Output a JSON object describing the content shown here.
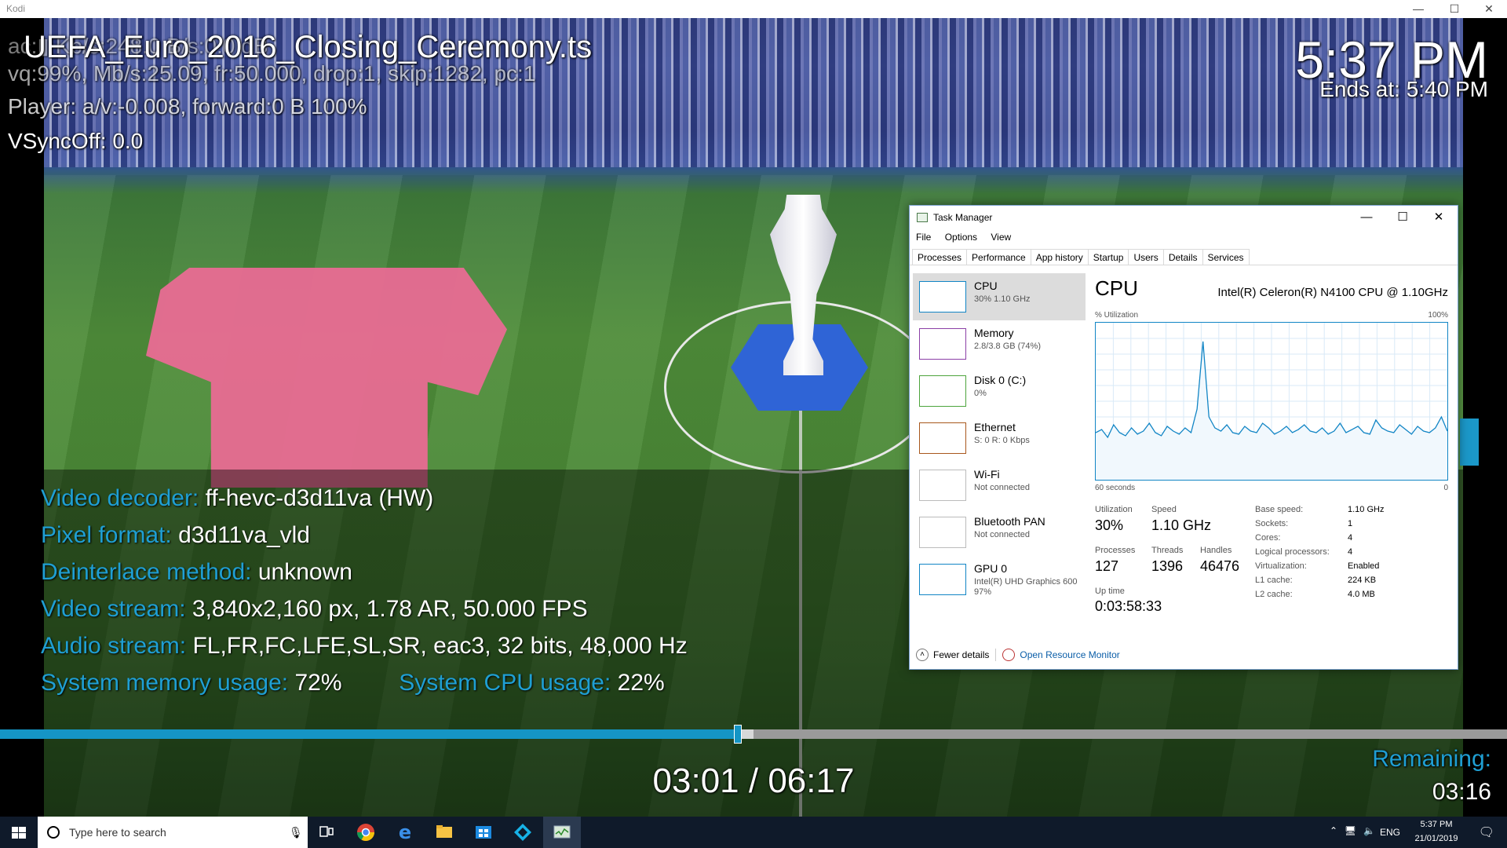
{
  "window": {
    "title": "Kodi"
  },
  "osd": {
    "debug_line1": "ac:▮ Kb/s:248.0 B/s:0.0 dB",
    "debug_line2": "vq:99%, Mb/s:25.09, fr:50.000, drop:1, skip:1282, pc:1",
    "debug_line3": "Player: a/v:-0.008, forward:0 B 100%",
    "debug_line4": "VSyncOff: 0.0",
    "file_title": "UEFA_Euro_2016_Closing_Ceremony.ts",
    "clock": "5:37 PM",
    "ends_at": "Ends at: 5:40 PM"
  },
  "info": {
    "video_decoder_label": "Video decoder:",
    "video_decoder_value": "ff-hevc-d3d11va (HW)",
    "pixel_format_label": "Pixel format:",
    "pixel_format_value": "d3d11va_vld",
    "deinterlace_label": "Deinterlace method:",
    "deinterlace_value": "unknown",
    "video_stream_label": "Video stream:",
    "video_stream_value": "3,840x2,160 px, 1.78 AR, 50.000 FPS",
    "audio_stream_label": "Audio stream:",
    "audio_stream_value": "FL,FR,FC,LFE,SL,SR, eac3, 32 bits, 48,000 Hz",
    "sys_mem_label": "System memory usage:",
    "sys_mem_value": "72%",
    "sys_cpu_label": "System CPU usage:",
    "sys_cpu_value": "22%"
  },
  "playback": {
    "progress_fraction": 0.489,
    "cache_fraction": 0.5,
    "timecode": "03:01 / 06:17",
    "remaining_label": "Remaining:",
    "remaining_value": "03:16",
    "accent_color": "#1595c5"
  },
  "task_manager": {
    "title": "Task Manager",
    "menu": [
      "File",
      "Options",
      "View"
    ],
    "tabs": [
      "Processes",
      "Performance",
      "App history",
      "Startup",
      "Users",
      "Details",
      "Services"
    ],
    "active_tab": "Performance",
    "sidebar": [
      {
        "name": "CPU",
        "sub": "30% 1.10 GHz",
        "sub2": "",
        "color": "#1185c5"
      },
      {
        "name": "Memory",
        "sub": "2.8/3.8 GB (74%)",
        "sub2": "",
        "color": "#8b3fa6"
      },
      {
        "name": "Disk 0 (C:)",
        "sub": "0%",
        "sub2": "",
        "color": "#4da43c"
      },
      {
        "name": "Ethernet",
        "sub": "S: 0 R: 0 Kbps",
        "sub2": "",
        "color": "#a8571c"
      },
      {
        "name": "Wi-Fi",
        "sub": "Not connected",
        "sub2": "",
        "color": "#bbbbbb"
      },
      {
        "name": "Bluetooth PAN",
        "sub": "Not connected",
        "sub2": "",
        "color": "#bbbbbb"
      },
      {
        "name": "GPU 0",
        "sub": "Intel(R) UHD Graphics 600",
        "sub2": "97%",
        "color": "#1185c5"
      }
    ],
    "main": {
      "heading": "CPU",
      "model": "Intel(R) Celeron(R) N4100 CPU @ 1.10GHz",
      "util_label": "% Utilization",
      "util_max": "100%",
      "graph_left": "60 seconds",
      "graph_right": "0",
      "cpu_series": [
        30,
        32,
        27,
        35,
        30,
        28,
        33,
        29,
        31,
        36,
        30,
        28,
        34,
        31,
        29,
        33,
        30,
        45,
        88,
        40,
        33,
        31,
        35,
        30,
        29,
        34,
        31,
        30,
        36,
        33,
        29,
        31,
        34,
        30,
        32,
        35,
        31,
        30,
        33,
        29,
        31,
        36,
        30,
        32,
        34,
        30,
        29,
        38,
        33,
        31,
        30,
        35,
        32,
        29,
        34,
        31,
        30,
        33,
        40,
        31
      ],
      "utilization_label": "Utilization",
      "utilization_value": "30%",
      "speed_label": "Speed",
      "speed_value": "1.10 GHz",
      "processes_label": "Processes",
      "processes_value": "127",
      "threads_label": "Threads",
      "threads_value": "1396",
      "handles_label": "Handles",
      "handles_value": "46476",
      "uptime_label": "Up time",
      "uptime_value": "0:03:58:33",
      "details": [
        {
          "k": "Base speed:",
          "v": "1.10 GHz"
        },
        {
          "k": "Sockets:",
          "v": "1"
        },
        {
          "k": "Cores:",
          "v": "4"
        },
        {
          "k": "Logical processors:",
          "v": "4"
        },
        {
          "k": "Virtualization:",
          "v": "Enabled"
        },
        {
          "k": "L1 cache:",
          "v": "224 KB"
        },
        {
          "k": "L2 cache:",
          "v": "4.0 MB"
        }
      ]
    },
    "footer": {
      "fewer": "Fewer details",
      "monitor": "Open Resource Monitor"
    }
  },
  "taskbar": {
    "search_placeholder": "Type here to search",
    "lang": "ENG",
    "time": "5:37 PM",
    "date": "21/01/2019"
  }
}
